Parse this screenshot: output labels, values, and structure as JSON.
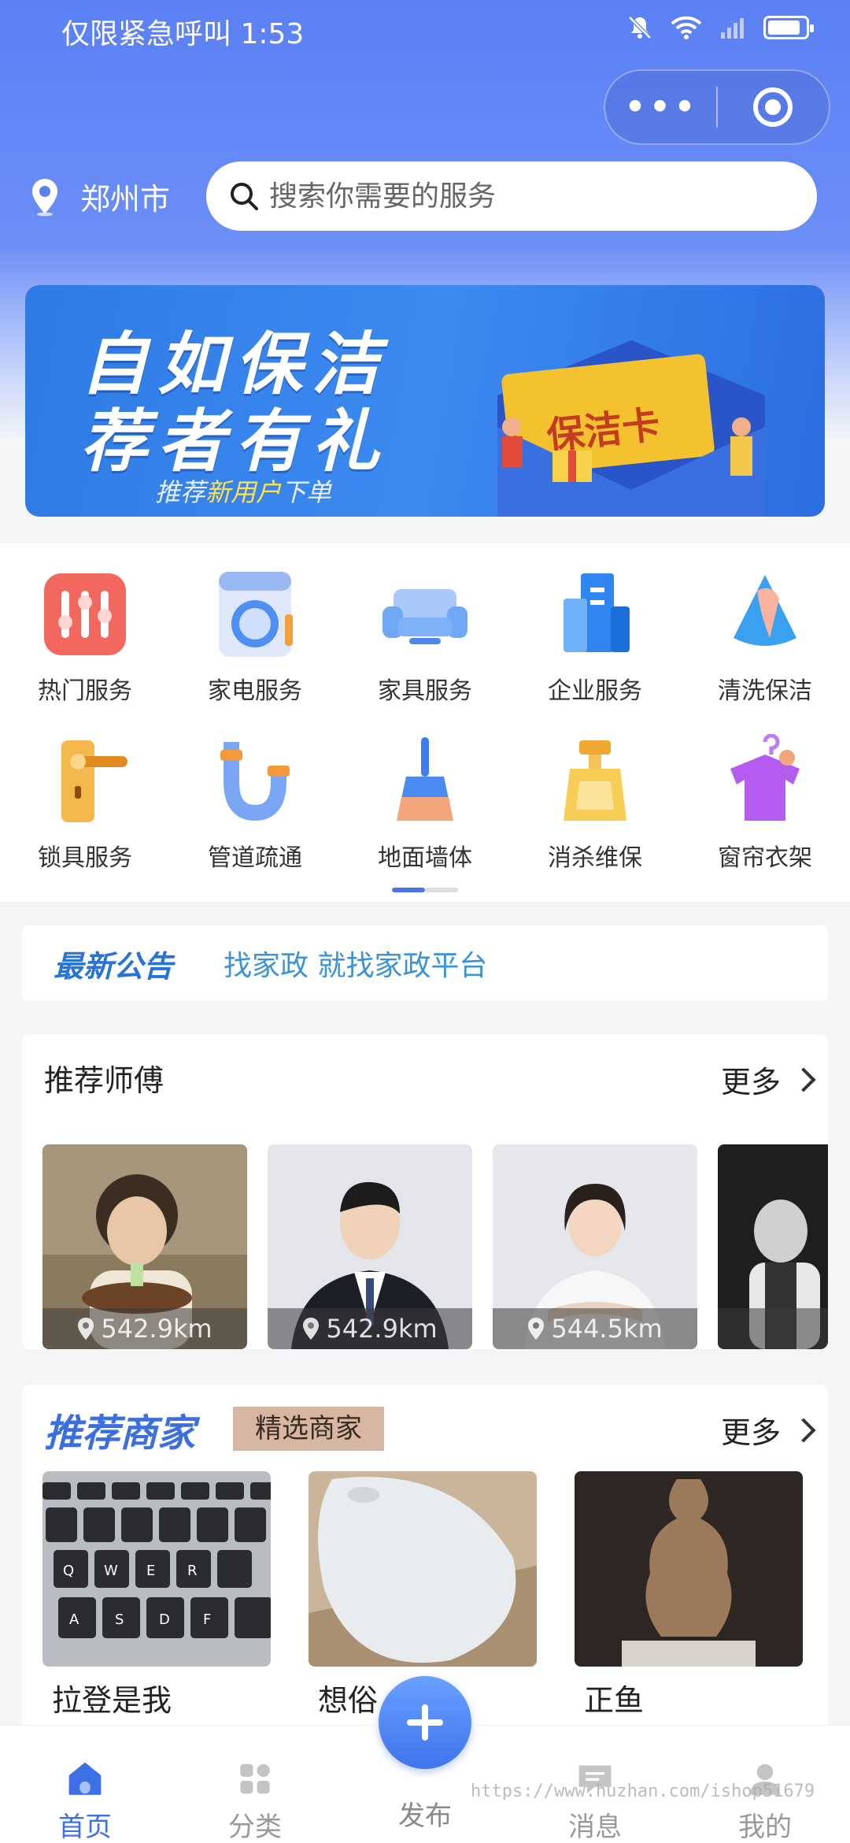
{
  "status_bar": {
    "text": "仅限紧急呼叫 1:53"
  },
  "header": {
    "city": "郑州市",
    "search_placeholder": "搜索你需要的服务"
  },
  "banner": {
    "line1": "自如保洁",
    "line2": "荐者有礼",
    "sub_pre": "推荐",
    "sub_hl": "新用户",
    "sub_post": "下单",
    "card_text": "保洁卡"
  },
  "categories": [
    {
      "label": "热门服务",
      "icon": "hot-service-icon",
      "color": "#f2675e"
    },
    {
      "label": "家电服务",
      "icon": "washing-machine-icon",
      "color": "#4f8ff2"
    },
    {
      "label": "家具服务",
      "icon": "sofa-icon",
      "color": "#6fa8f5"
    },
    {
      "label": "企业服务",
      "icon": "building-icon",
      "color": "#2f86f0"
    },
    {
      "label": "清洗保洁",
      "icon": "cleaning-cloth-icon",
      "color": "#3aa0f0"
    },
    {
      "label": "锁具服务",
      "icon": "door-lock-icon",
      "color": "#f2a23a"
    },
    {
      "label": "管道疏通",
      "icon": "pipe-icon",
      "color": "#5e8ff0"
    },
    {
      "label": "地面墙体",
      "icon": "broom-icon",
      "color": "#3e7df0"
    },
    {
      "label": "消杀维保",
      "icon": "spray-bottle-icon",
      "color": "#f4b73a"
    },
    {
      "label": "窗帘衣架",
      "icon": "clothes-hanger-icon",
      "color": "#b45cf0"
    }
  ],
  "notice": {
    "tag": "最新公告",
    "message": "找家政 就找家政平台"
  },
  "masters": {
    "title": "推荐师傅",
    "more": "更多",
    "items": [
      {
        "distance": "542.9km"
      },
      {
        "distance": "542.9km"
      },
      {
        "distance": "544.5km"
      },
      {
        "distance": ""
      }
    ]
  },
  "merchants": {
    "title": "推荐商家",
    "tag": "精选商家",
    "more": "更多",
    "items": [
      {
        "name": "拉登是我"
      },
      {
        "name": "想俗"
      },
      {
        "name": "正鱼"
      }
    ]
  },
  "tabbar": {
    "items": [
      {
        "label": "首页",
        "icon": "home-icon",
        "active": true
      },
      {
        "label": "分类",
        "icon": "category-grid-icon",
        "active": false
      },
      {
        "label": "发布",
        "icon": "plus-icon",
        "active": false
      },
      {
        "label": "消息",
        "icon": "message-icon",
        "active": false
      },
      {
        "label": "我的",
        "icon": "user-icon",
        "active": false
      }
    ]
  },
  "watermark": "https://www.huzhan.com/ishop51679",
  "colors": {
    "primary": "#3d6fe5",
    "header": "#5b80f4",
    "notice_tag": "#2873d6",
    "tag_bg": "#d7b7a4"
  }
}
